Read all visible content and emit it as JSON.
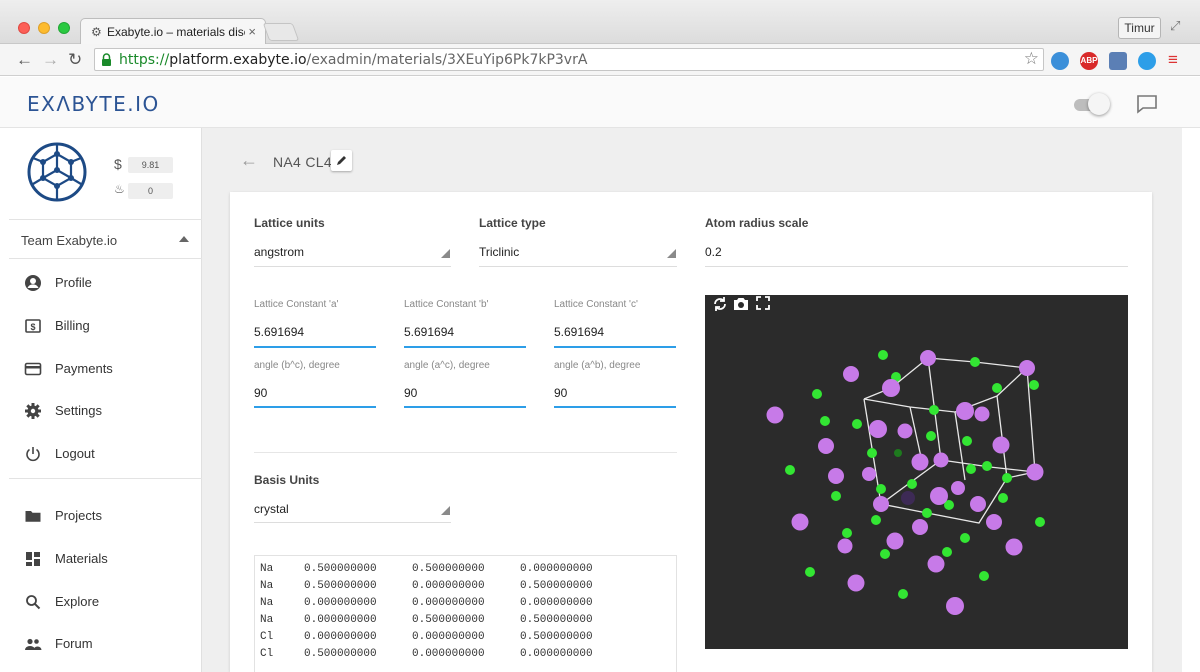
{
  "browser": {
    "tab_title": "Exabyte.io – materials disc",
    "tab_close": "×",
    "user_button": "Timur",
    "url_scheme": "https://",
    "url_host": "platform.exabyte.io",
    "url_path": "/exadmin/materials/3XEuYip6Pk7kP3vrA",
    "ext_abp": "ABP"
  },
  "app": {
    "logo": "EXΛBYTE.IO"
  },
  "sidebar": {
    "balance": "9.81",
    "credits": "0",
    "team": "Team Exabyte.io",
    "items": [
      {
        "label": "Profile",
        "icon": "account-circle-icon"
      },
      {
        "label": "Billing",
        "icon": "billing-icon"
      },
      {
        "label": "Payments",
        "icon": "credit-card-icon"
      },
      {
        "label": "Settings",
        "icon": "gear-icon"
      },
      {
        "label": "Logout",
        "icon": "power-icon"
      },
      {
        "label": "Projects",
        "icon": "folder-icon"
      },
      {
        "label": "Materials",
        "icon": "dashboard-icon"
      },
      {
        "label": "Explore",
        "icon": "search-icon"
      },
      {
        "label": "Forum",
        "icon": "people-icon"
      }
    ]
  },
  "material": {
    "name": "NA4 CL4"
  },
  "form": {
    "lattice_units_label": "Lattice units",
    "lattice_units_value": "angstrom",
    "lattice_type_label": "Lattice type",
    "lattice_type_value": "Triclinic",
    "atom_radius_label": "Atom radius scale",
    "atom_radius_value": "0.2",
    "const_a_label": "Lattice Constant 'a'",
    "const_a_value": "5.691694",
    "const_b_label": "Lattice Constant 'b'",
    "const_b_value": "5.691694",
    "const_c_label": "Lattice Constant 'c'",
    "const_c_value": "5.691694",
    "angle_bc_label": "angle (b^c), degree",
    "angle_bc_value": "90",
    "angle_ac_label": "angle (a^c), degree",
    "angle_ac_value": "90",
    "angle_ab_label": "angle (a^b), degree",
    "angle_ab_value": "90",
    "basis_units_label": "Basis Units",
    "basis_units_value": "crystal"
  },
  "basis": [
    {
      "el": "Na",
      "x": "0.500000000",
      "y": "0.500000000",
      "z": "0.000000000"
    },
    {
      "el": "Na",
      "x": "0.500000000",
      "y": "0.000000000",
      "z": "0.500000000"
    },
    {
      "el": "Na",
      "x": "0.000000000",
      "y": "0.000000000",
      "z": "0.000000000"
    },
    {
      "el": "Na",
      "x": "0.000000000",
      "y": "0.500000000",
      "z": "0.500000000"
    },
    {
      "el": "Cl",
      "x": "0.000000000",
      "y": "0.000000000",
      "z": "0.500000000"
    },
    {
      "el": "Cl",
      "x": "0.500000000",
      "y": "0.000000000",
      "z": "0.000000000"
    }
  ],
  "colors": {
    "accent_blue": "#2d9ee8",
    "logo_blue": "#2c5494",
    "na_atom": "#c77ae8",
    "cl_atom": "#3de63d",
    "viewer_bg": "#2b2b2b"
  }
}
